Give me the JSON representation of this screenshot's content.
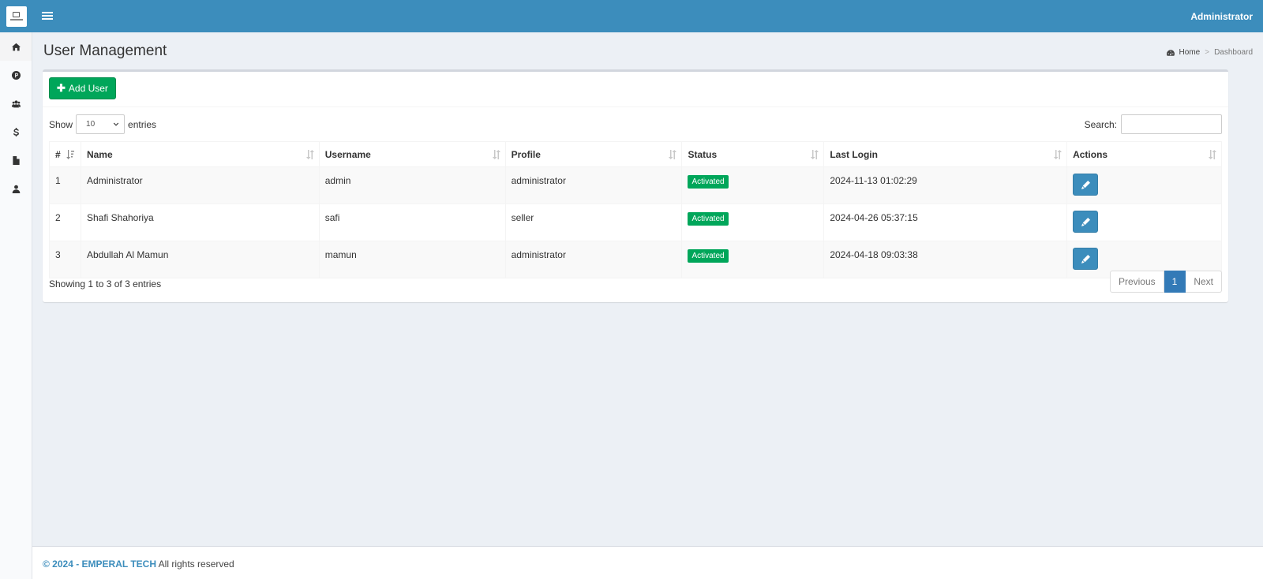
{
  "header": {
    "user_name": "Administrator"
  },
  "page": {
    "title": "User Management"
  },
  "breadcrumb": {
    "home": "Home",
    "current": "Dashboard"
  },
  "toolbar": {
    "add_label": "Add User"
  },
  "length": {
    "show": "Show",
    "value": "10",
    "entries": "entries"
  },
  "search": {
    "label": "Search:",
    "value": ""
  },
  "table": {
    "columns": [
      "#",
      "Name",
      "Username",
      "Profile",
      "Status",
      "Last Login",
      "Actions"
    ],
    "rows": [
      {
        "no": "1",
        "name": "Administrator",
        "username": "admin",
        "profile": "administrator",
        "status": "Activated",
        "last_login": "2024-11-13 01:02:29"
      },
      {
        "no": "2",
        "name": "Shafi Shahoriya",
        "username": "safi",
        "profile": "seller",
        "status": "Activated",
        "last_login": "2024-04-26 05:37:15"
      },
      {
        "no": "3",
        "name": "Abdullah Al Mamun",
        "username": "mamun",
        "profile": "administrator",
        "status": "Activated",
        "last_login": "2024-04-18 09:03:38"
      }
    ]
  },
  "info": "Showing 1 to 3 of 3 entries",
  "pagination": {
    "previous": "Previous",
    "current": "1",
    "next": "Next"
  },
  "footer": {
    "copyright": "© 2024 - EMPERAL TECH",
    "rights": " All rights reserved"
  },
  "icons": {
    "sidebar": [
      "home-icon",
      "parking-icon",
      "users-icon",
      "dollar-icon",
      "file-icon",
      "user-icon"
    ],
    "sort": "sort-icon",
    "edit": "pencil-icon"
  },
  "colors": {
    "primary": "#3c8dbc",
    "success": "#00a65a",
    "background": "#ecf0f5"
  }
}
